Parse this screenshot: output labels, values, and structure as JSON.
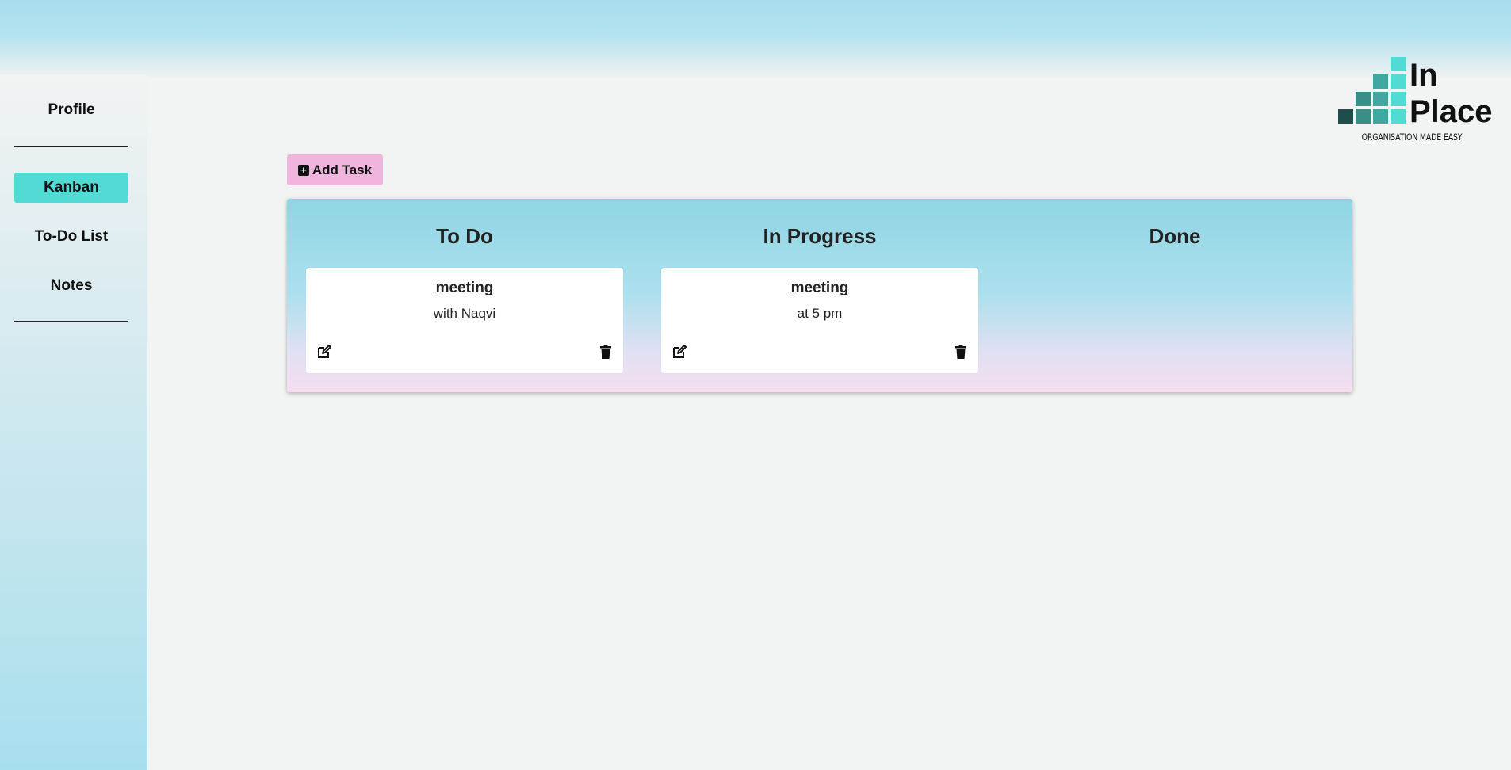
{
  "nav": {
    "profile": "Profile",
    "kanban": "Kanban",
    "todo": "To-Do List",
    "notes": "Notes"
  },
  "logo": {
    "line1": "In",
    "line2": "Place",
    "tagline": "ORGANISATION MADE EASY"
  },
  "toolbar": {
    "add_task_label": "Add Task",
    "add_icon": "plus-square-icon"
  },
  "board": {
    "columns": [
      {
        "title": "To Do",
        "cards": [
          {
            "title": "meeting",
            "description": "with Naqvi"
          }
        ]
      },
      {
        "title": "In Progress",
        "cards": [
          {
            "title": "meeting",
            "description": "at 5 pm"
          }
        ]
      },
      {
        "title": "Done",
        "cards": []
      }
    ]
  },
  "icons": {
    "edit": "edit-icon",
    "delete": "trash-icon"
  },
  "colors": {
    "active_nav": "#52dbd4",
    "add_task_button": "#efb5dd",
    "header_blue": "#a8dfee",
    "logo_dark": "#1f4d49",
    "logo_mid": "#3a9a92",
    "logo_light": "#52dbd4"
  }
}
